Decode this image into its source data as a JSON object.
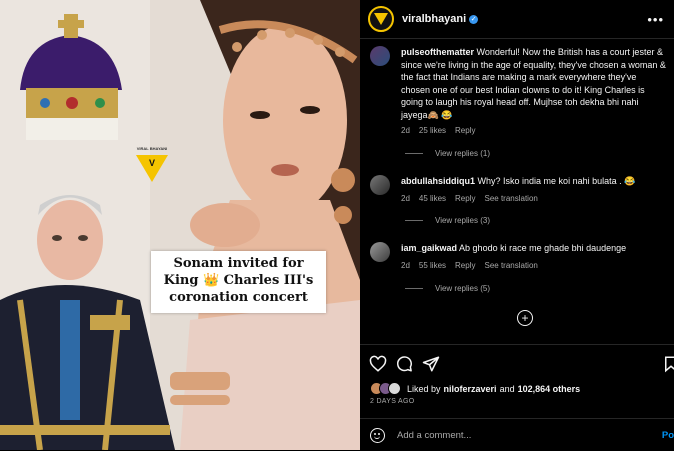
{
  "post": {
    "caption_lines": [
      "Sonam invited for",
      "King 👑 Charles III's",
      "coronation concert"
    ],
    "watermark": "VIRAL BHAYANI"
  },
  "header": {
    "username": "viralbhayani",
    "more": "•••"
  },
  "comments": [
    {
      "user": "pulseofthematter",
      "text": "Wonderful! Now the British has a court jester & since we're living in the age of equality, they've chosen a woman & the fact that Indians are making a mark everywhere they've chosen one of our best Indian clowns to do it! King Charles is going to laugh his royal head off. Mujhse toh dekha bhi nahi jayega🙈 😂",
      "age": "2d",
      "likes": "25 likes",
      "reply": "Reply",
      "translation": "",
      "view_replies": "View replies (1)"
    },
    {
      "user": "abdullahsiddiqu1",
      "text": "Why? Isko india me koi nahi bulata . 😂",
      "age": "2d",
      "likes": "45 likes",
      "reply": "Reply",
      "translation": "See translation",
      "view_replies": "View replies (3)"
    },
    {
      "user": "iam_gaikwad",
      "text": "Ab ghodo ki race me ghade bhi daudenge",
      "age": "2d",
      "likes": "55 likes",
      "reply": "Reply",
      "translation": "See translation",
      "view_replies": "View replies (5)"
    }
  ],
  "likes": {
    "prefix": "Liked by",
    "user": "niloferzaveri",
    "and": "and",
    "count": "102,864 others"
  },
  "time_ago": "2 DAYS AGO",
  "add_comment": {
    "placeholder": "Add a comment...",
    "post_label": "Po"
  },
  "colors": {
    "accent_blue": "#0095f6",
    "verified": "#3897f0",
    "brand_yellow": "#f5c400"
  }
}
